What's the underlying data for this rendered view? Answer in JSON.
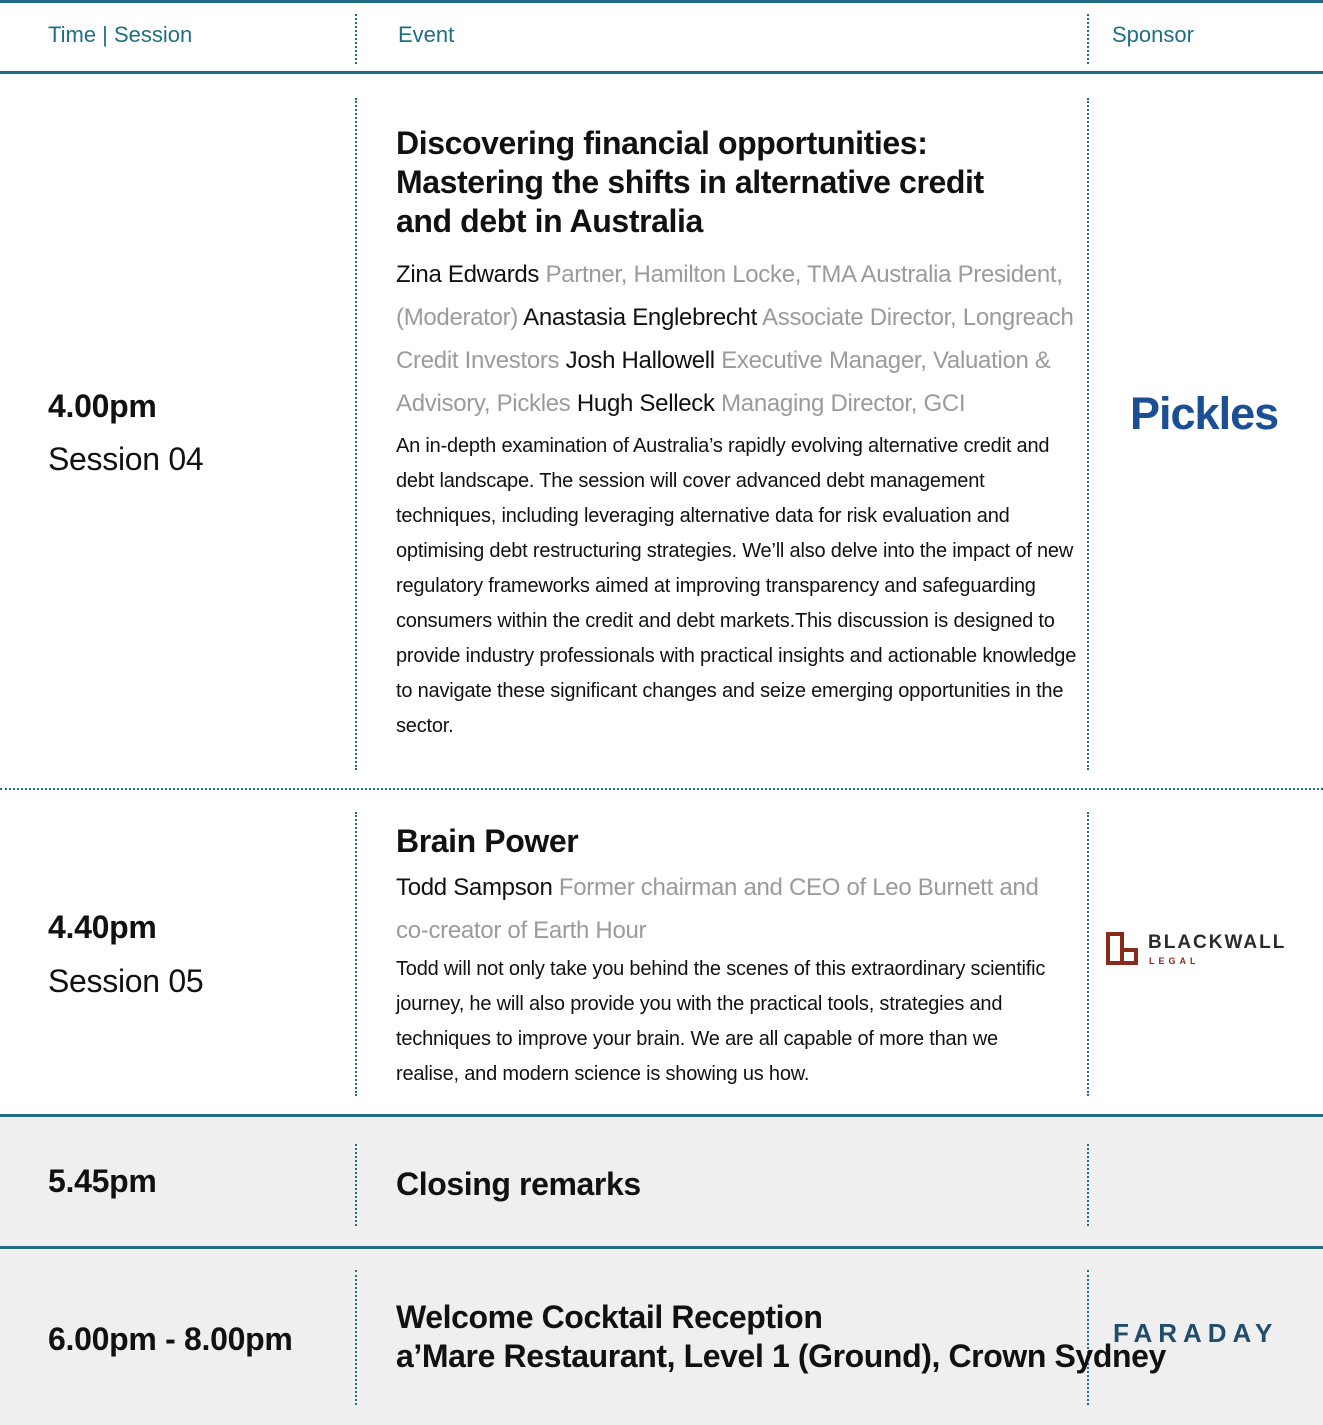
{
  "header": {
    "time_session": "Time | Session",
    "event": "Event",
    "sponsor": "Sponsor"
  },
  "rows": [
    {
      "time": "4.00pm",
      "session": "Session 04",
      "title_lines": [
        "Discovering financial opportunities:",
        "Mastering the shifts in alternative credit",
        "and debt in Australia"
      ],
      "speakers": [
        {
          "name": "Zina Edwards",
          "role": "Partner, Hamilton Locke, TMA Australia President, (Moderator)"
        },
        {
          "name": "Anastasia Englebrecht",
          "role": "Associate Director, Longreach Credit Investors"
        },
        {
          "name": "Josh Hallowell",
          "role": "Executive Manager, Valuation & Advisory, Pickles"
        },
        {
          "name": "Hugh Selleck",
          "role": "Managing Director, GCI"
        }
      ],
      "description": "An in-depth examination of Australia’s rapidly evolving alternative credit and debt landscape. The session will cover advanced debt management techniques, including leveraging alternative data for risk evaluation and optimising debt restructuring strategies. We’ll also delve into the impact of new regulatory frameworks aimed at improving transparency and safeguarding consumers within the credit and debt markets.This discussion is designed to provide industry professionals with practical insights and actionable knowledge to navigate these significant changes and seize emerging opportunities in the sector.",
      "sponsor": "Pickles"
    },
    {
      "time": "4.40pm",
      "session": "Session 05",
      "title": "Brain Power",
      "speakers": [
        {
          "name": "Todd Sampson",
          "role": "Former chairman and CEO of Leo Burnett and co-creator of Earth Hour"
        }
      ],
      "description": "Todd will not only take you behind the scenes of this extraordinary scientific journey, he will also provide you with the practical tools, strategies and techniques to improve your brain. We are all capable of more than we realise, and modern science is showing us how.",
      "sponsor": {
        "name": "BLACKWALL",
        "sub": "LEGAL"
      }
    },
    {
      "time": "5.45pm",
      "title": "Closing remarks"
    },
    {
      "time": "6.00pm - 8.00pm",
      "title_lines": [
        "Welcome Cocktail Reception",
        "a’Mare Restaurant, Level 1 (Ground), Crown Sydney"
      ],
      "sponsor": "FARADAY"
    }
  ],
  "colors": {
    "accent": "#1f6e86",
    "pickles_blue": "#1a4f95",
    "blackwall_red": "#8a2a1a",
    "faraday_blue": "#1f4d6b",
    "speaker_role_grey": "#9b9b9b",
    "shaded_row": "#efefef"
  }
}
